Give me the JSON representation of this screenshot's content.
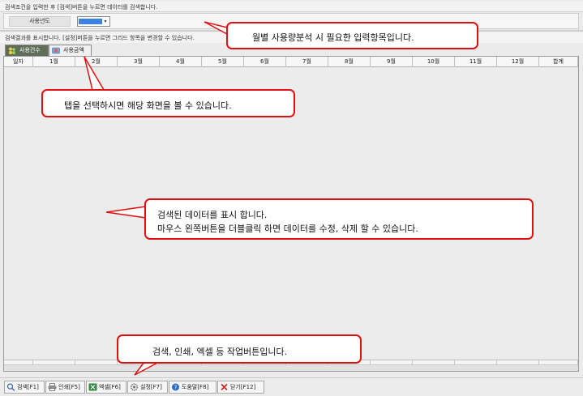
{
  "hint_top": "검색조건을 입력한 후 [검색]버튼을 누르면 데이터를 검색합니다.",
  "condition": {
    "year_label": "사용년도",
    "year_value": "",
    "year_arrow": "▾",
    "year_color": "#3a84e0"
  },
  "result_hint": "검색결과를 표시합니다. [설정]버튼을 누르면 그리드 항목을 변경할 수 있습니다.",
  "tabs": [
    {
      "label": "사용건수",
      "icon": "people-icon",
      "active": true
    },
    {
      "label": "사용금액",
      "icon": "money-icon",
      "active": false
    }
  ],
  "grid": {
    "columns": [
      "일자",
      "1월",
      "2월",
      "3월",
      "4월",
      "5월",
      "6월",
      "7월",
      "8월",
      "9월",
      "10월",
      "11월",
      "12월",
      "합계"
    ],
    "rows": []
  },
  "toolbar": {
    "search": "검색[F1]",
    "print": "인쇄[F5]",
    "excel": "엑셀[F6]",
    "settings": "설정[F7]",
    "help": "도움말[F8]",
    "close": "닫기[F12]"
  },
  "callouts": {
    "input_note": "월별 사용량분석 시 필요한 입력항목입니다.",
    "tab_note": "탭을 선택하시면 해당 화면을 볼 수 있습니다.",
    "grid_note_line1": "검색된 데이터를 표시 합니다.",
    "grid_note_line2": "마우스 왼쪽버튼을 더블클릭 하면 데이터를 수정, 삭제 할 수 있습니다.",
    "toolbar_note": "검색, 인쇄, 엑셀  등 작업버튼입니다."
  },
  "colors": {
    "callout_border": "#e01010",
    "active_tab_bg": "#5e6e57"
  }
}
